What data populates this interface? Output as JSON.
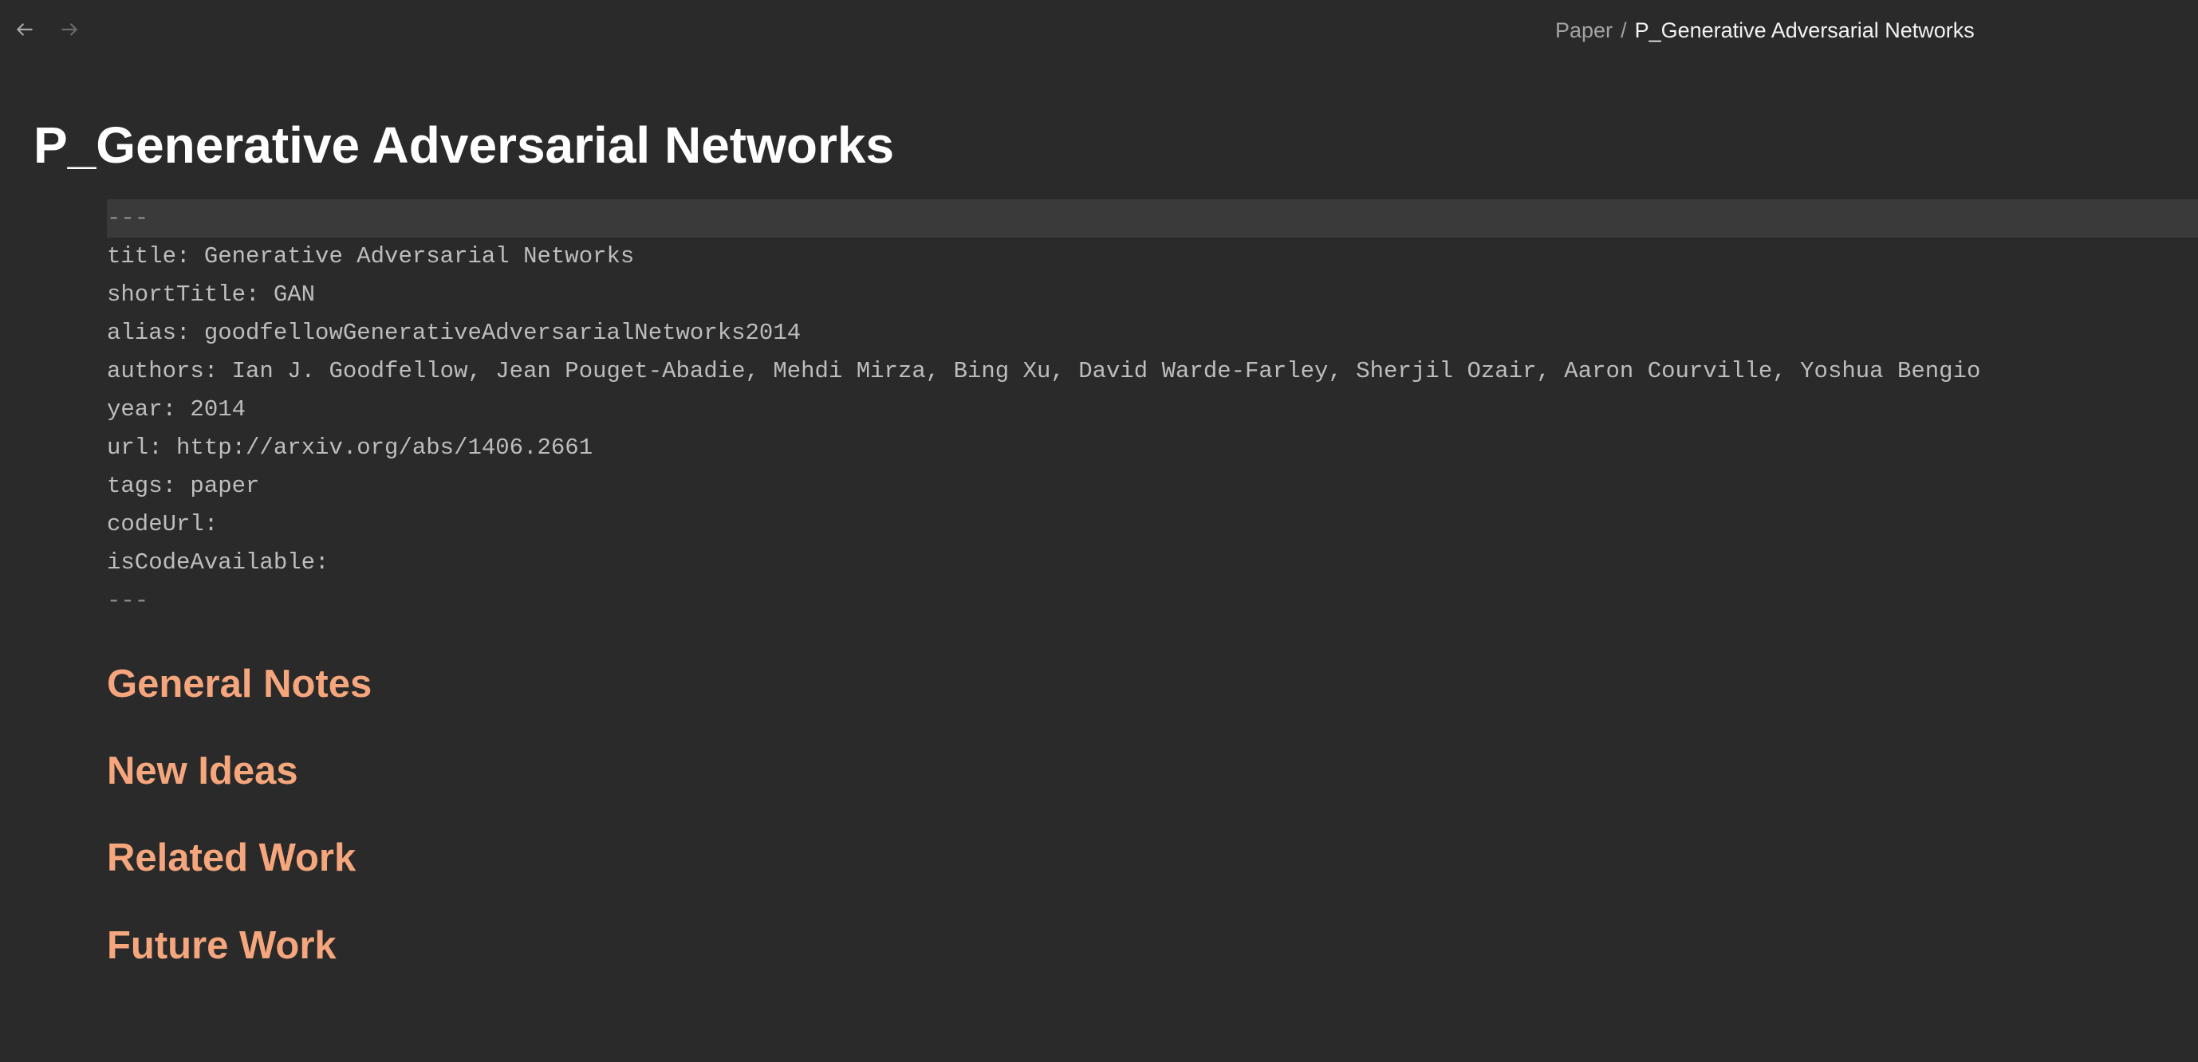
{
  "breadcrumb": {
    "parent": "Paper",
    "separator": "/",
    "current": "P_Generative Adversarial Networks"
  },
  "page": {
    "title": "P_Generative Adversarial Networks"
  },
  "frontmatter": {
    "open_delimiter": "---",
    "lines": [
      "title: Generative Adversarial Networks",
      "shortTitle: GAN",
      "alias: goodfellowGenerativeAdversarialNetworks2014",
      "authors: Ian J. Goodfellow, Jean Pouget-Abadie, Mehdi Mirza, Bing Xu, David Warde-Farley, Sherjil Ozair, Aaron Courville, Yoshua Bengio",
      "year: 2014",
      "url: http://arxiv.org/abs/1406.2661",
      "tags: paper",
      "codeUrl:",
      "isCodeAvailable:"
    ],
    "close_delimiter": "---"
  },
  "sections": [
    "General Notes",
    "New Ideas",
    "Related Work",
    "Future Work"
  ],
  "icons": {
    "back": "arrow-left-icon",
    "forward": "arrow-right-icon"
  },
  "colors": {
    "background": "#2a2a2a",
    "heading_accent": "#f5a67c",
    "active_line": "#3a3a3a"
  }
}
